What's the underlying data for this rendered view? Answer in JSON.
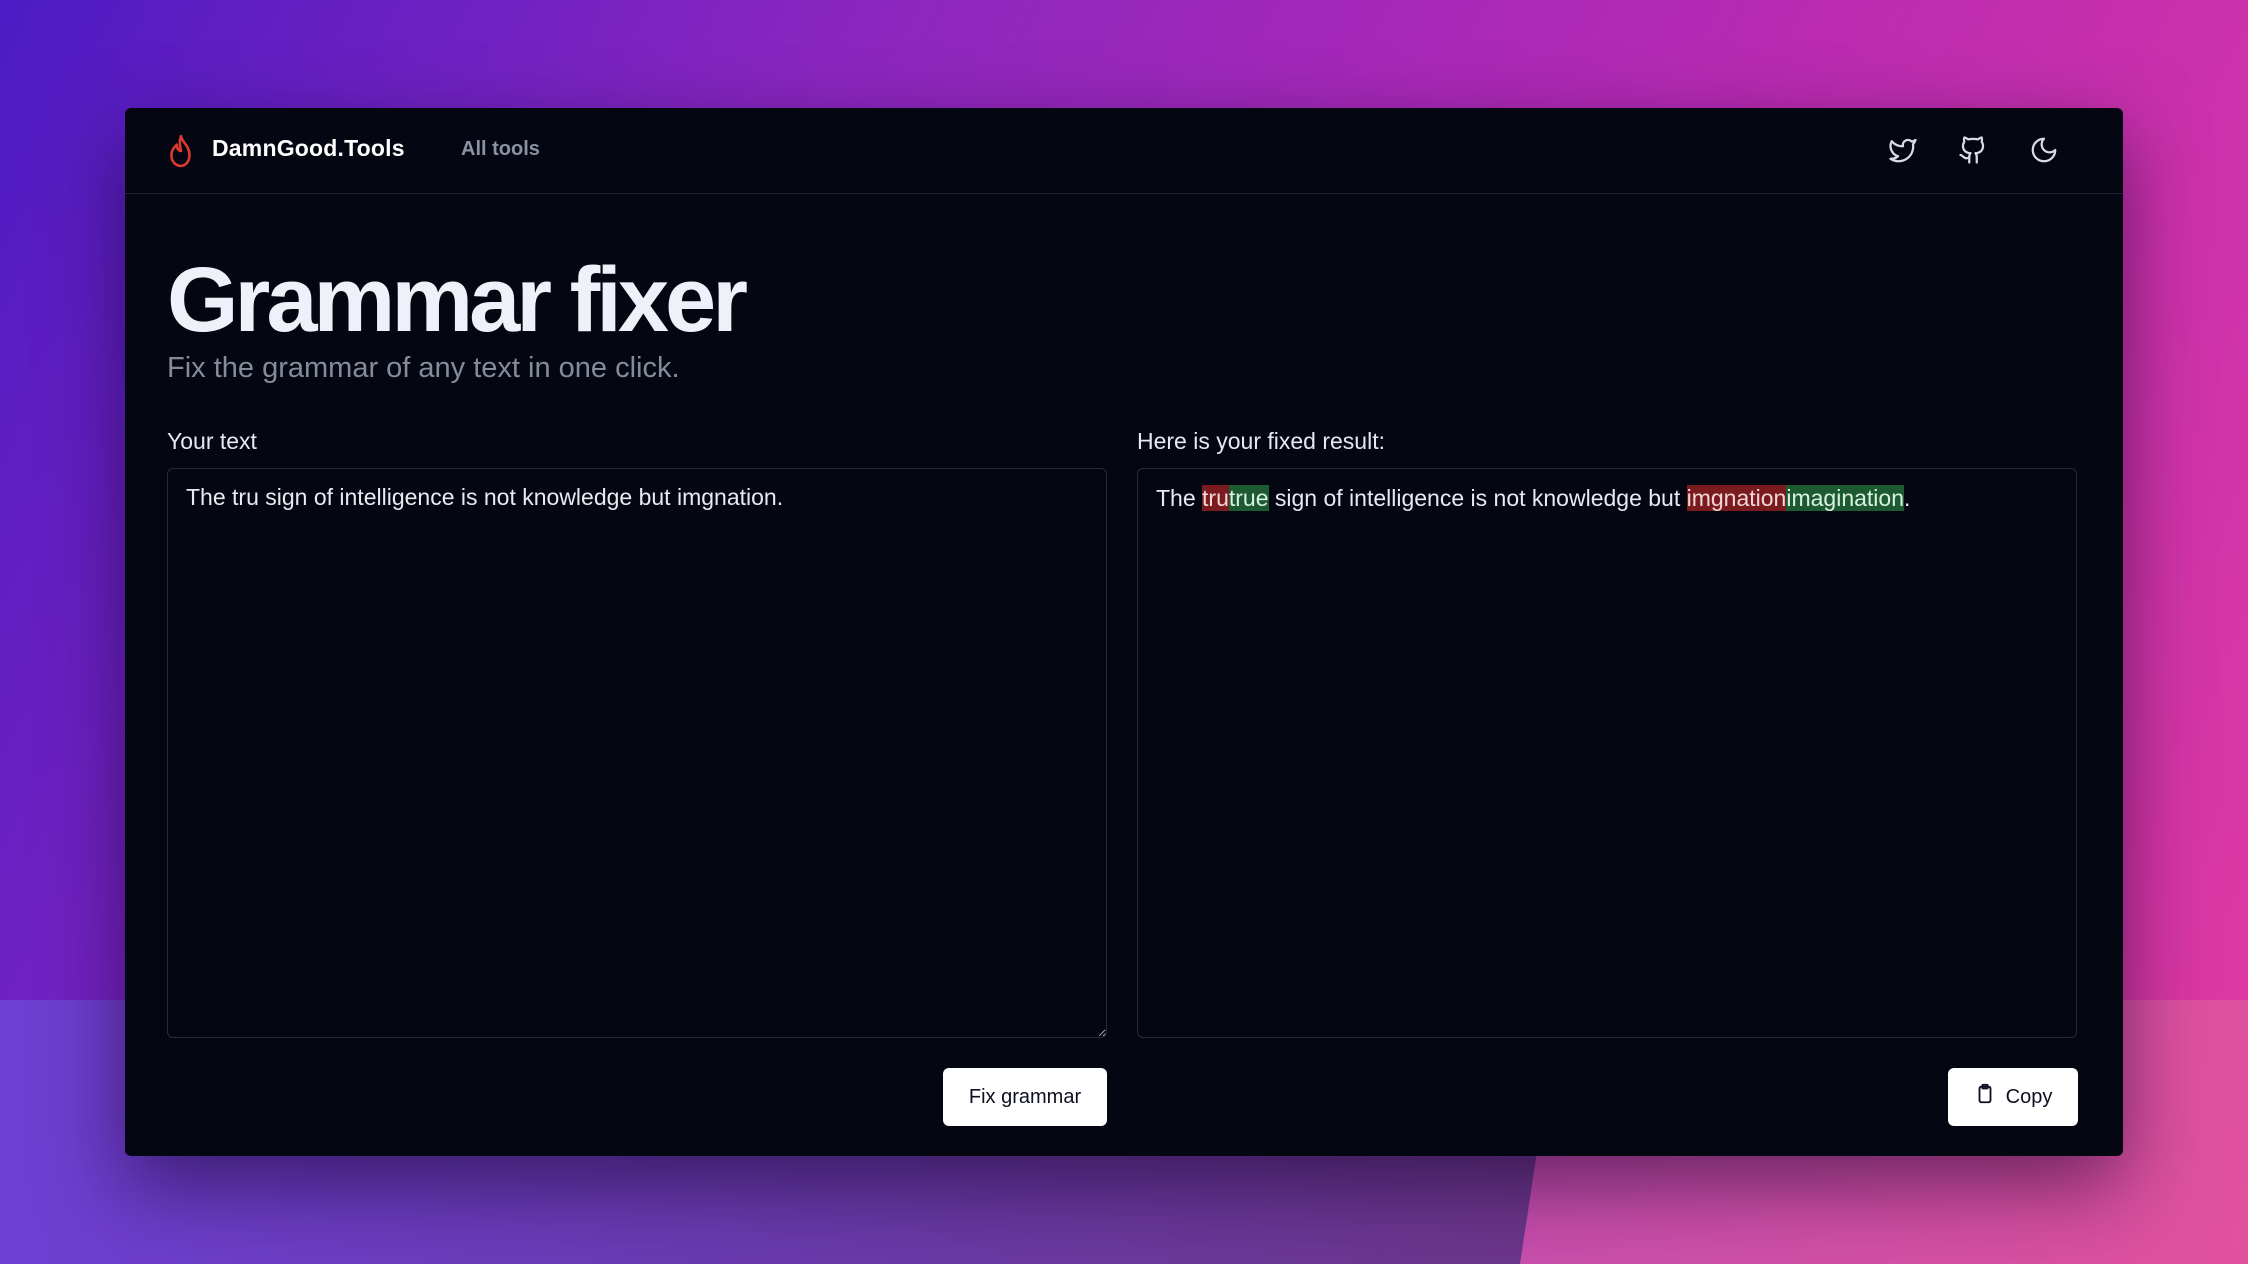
{
  "header": {
    "brand": "DamnGood.Tools",
    "nav_link": "All tools",
    "icons": [
      "flame-icon",
      "twitter-icon",
      "github-icon",
      "moon-icon"
    ]
  },
  "page": {
    "title": "Grammar fixer",
    "subtitle": "Fix the grammar of any text in one click."
  },
  "input": {
    "label": "Your text",
    "value": "The tru sign of intelligence is not knowledge but imgnation."
  },
  "result": {
    "label": "Here is your fixed result:",
    "segments": [
      {
        "text": "The ",
        "type": "same"
      },
      {
        "text": "tru",
        "type": "removed"
      },
      {
        "text": "true",
        "type": "added"
      },
      {
        "text": " sign of intelligence is not knowledge but ",
        "type": "same"
      },
      {
        "text": "imgnation",
        "type": "removed"
      },
      {
        "text": "imagination",
        "type": "added"
      },
      {
        "text": ".",
        "type": "same"
      }
    ]
  },
  "actions": {
    "fix_label": "Fix grammar",
    "copy_label": "Copy"
  },
  "colors": {
    "window_bg": "#040711",
    "removed_bg": "#7a1c1f",
    "added_bg": "#1d5a32",
    "flame": "#e0392f"
  }
}
